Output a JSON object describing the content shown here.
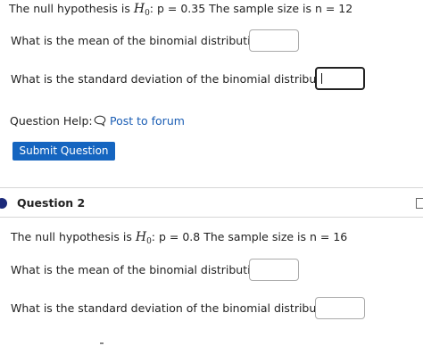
{
  "question1": {
    "hypothesis_prefix": "The null hypothesis is ",
    "hypothesis_symbol": "H",
    "hypothesis_subscript": "0",
    "hypothesis_suffix": ": p = 0.35 The sample size is n = 12",
    "mean_prompt": "What is the mean of the binomial distribution?",
    "mean_value": "",
    "sd_prompt": "What is the standard deviation of the binomial distribution?",
    "sd_value": ""
  },
  "help": {
    "label": "Question Help:",
    "icon": "speech-bubble-icon",
    "link": "Post to forum"
  },
  "submit_label": "Submit Question",
  "question2": {
    "heading": "Question 2",
    "hypothesis_prefix": "The null hypothesis is ",
    "hypothesis_symbol": "H",
    "hypothesis_subscript": "0",
    "hypothesis_suffix": ": p = 0.8 The sample size is n = 16",
    "mean_prompt": "What is the mean of the binomial distribution?",
    "mean_value": "",
    "sd_prompt": "What is the standard deviation of the binomial distribution?",
    "sd_value": ""
  },
  "colors": {
    "accent": "#1565c0",
    "link": "#1a5db4",
    "bullet": "#1b2a7a"
  }
}
